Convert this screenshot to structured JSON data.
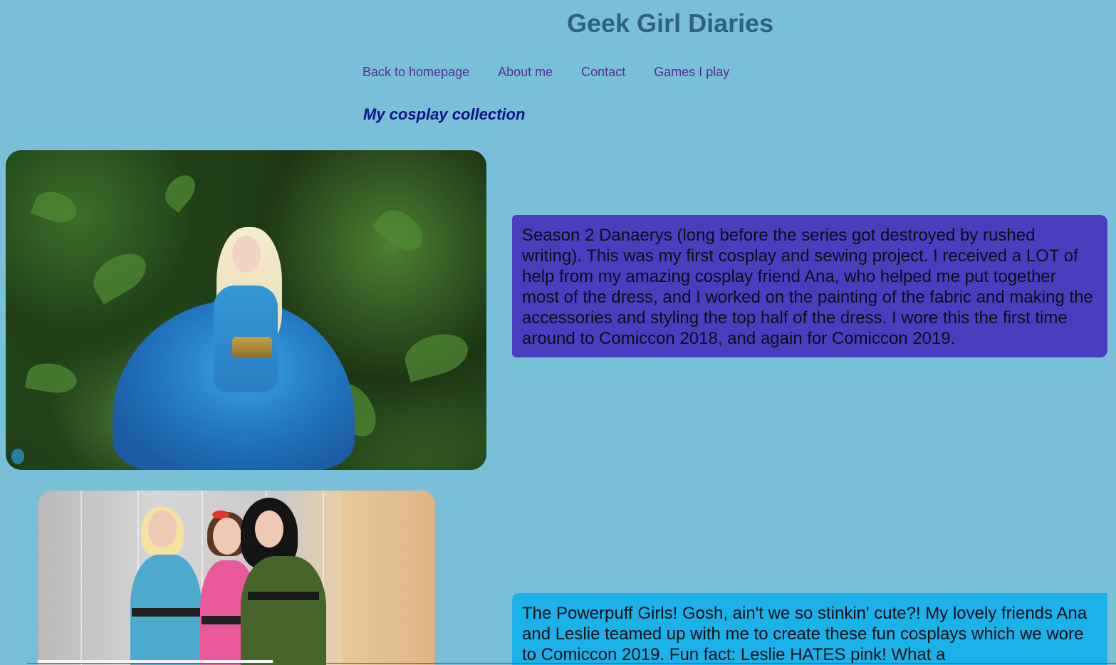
{
  "site": {
    "title": "Geek Girl Diaries"
  },
  "nav": {
    "items": [
      {
        "label": "Back to homepage"
      },
      {
        "label": "About me"
      },
      {
        "label": "Contact"
      },
      {
        "label": "Games I play"
      }
    ]
  },
  "main": {
    "heading": "My cosplay collection",
    "entries": [
      {
        "image_alt": "Season 2 Daenerys cosplay photo",
        "caption": "Season 2 Danaerys (long before the series got destroyed by rushed writing). This was my first cosplay and sewing project. I received a LOT of help from my amazing cosplay friend Ana, who helped me put together most of the dress, and I worked on the painting of the fabric and making the accessories and styling the top half of the dress. I wore this the first time around to Comiccon 2018, and again for Comiccon 2019."
      },
      {
        "image_alt": "Powerpuff Girls cosplay photo",
        "caption": "The Powerpuff Girls! Gosh, ain't we so stinkin' cute?! My lovely friends Ana and Leslie teamed up with me to create these fun cosplays which we wore to Comiccon 2019. Fun fact: Leslie HATES pink! What a"
      }
    ]
  },
  "colors": {
    "background": "#78bfd7",
    "title": "#2f6181",
    "nav_link": "#5b2d91",
    "heading": "#12108a",
    "caption_1_bg": "#483fbf",
    "caption_2_bg": "#1bb2e9"
  }
}
